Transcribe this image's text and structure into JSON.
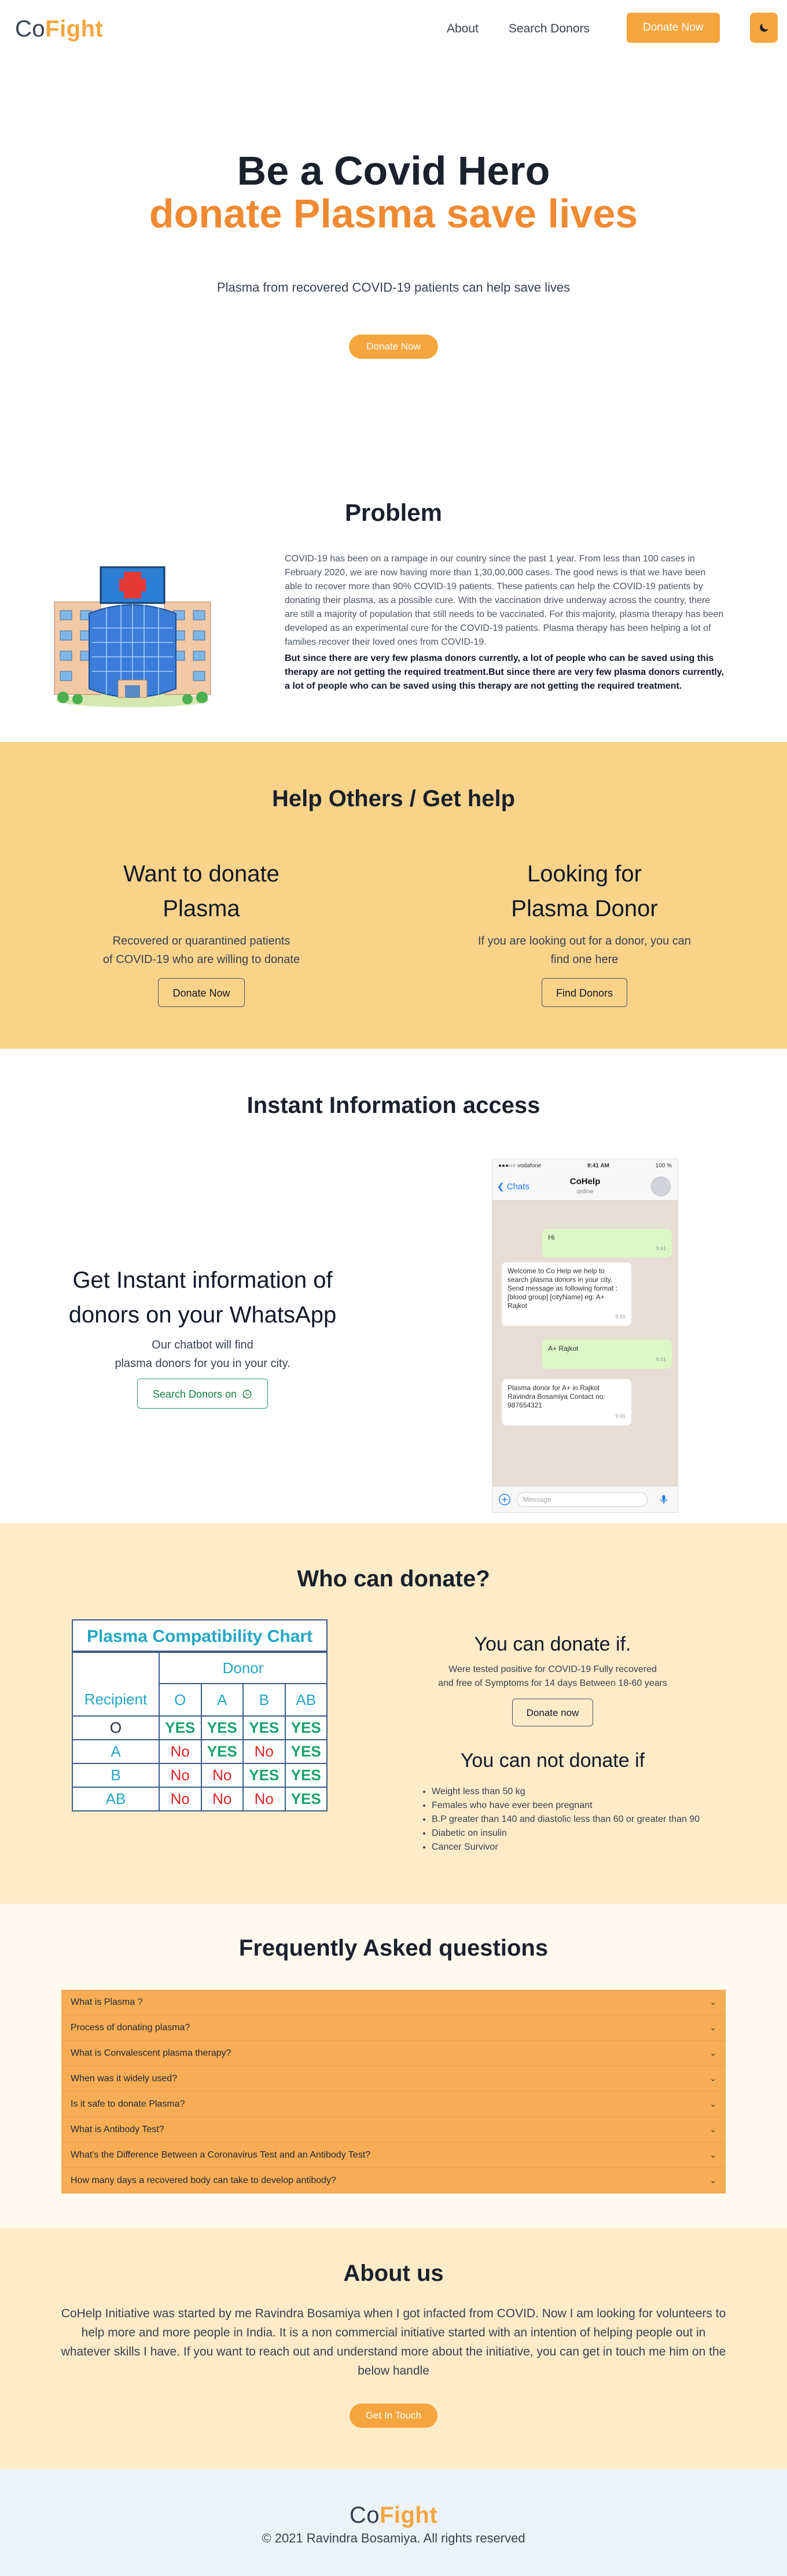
{
  "nav": {
    "logo_co": "Co",
    "logo_fight": "Fight",
    "links": [
      "About",
      "Search Donors"
    ],
    "donate_label": "Donate Now",
    "theme_icon": "moon-icon"
  },
  "hero": {
    "title_line1": "Be a Covid Hero",
    "title_line2": "donate Plasma save lives",
    "subtitle": "Plasma from recovered COVID-19 patients can help save lives",
    "button": "Donate Now"
  },
  "problem": {
    "title": "Problem",
    "paragraph": "COVID-19 has been on a rampage in our country since the past 1 year. From less than 100 cases in February 2020, we are now having more than 1,30,00,000 cases. The good news is that we have been able to recover more than 90% COVID-19 patients. These patients can help the COVID-19 patients by donating their plasma, as a possible cure. With the vaccination drive underway across the country, there are still a majority of population that still needs to be vaccinated. For this majority, plasma therapy has been developed as an experimental cure for the COVID-19 patients. Plasma therapy has been helping a lot of families recover their loved ones from COVID-19.",
    "bold": "But since there are very few plasma donors currently, a lot of people who can be saved using this therapy are not getting the required treatment.But since there are very few plasma donors currently, a lot of people who can be saved using this therapy are not getting the required treatment."
  },
  "help": {
    "title": "Help Others / Get help",
    "left": {
      "title": "Want to donate Plasma",
      "text_line1": "Recovered or quarantined patients",
      "text_line2": "of COVID-19 who are willing to donate",
      "button": "Donate Now"
    },
    "right": {
      "title": "Looking for Plasma Donor",
      "text_line1": "If you are looking out for a donor, you can",
      "text_line2": "find one here",
      "button": "Find Donors"
    }
  },
  "instant": {
    "title": "Instant Information access",
    "heading": "Get Instant information of donors on your WhatsApp",
    "text_line1": "Our chatbot will find",
    "text_line2": "plasma donors for you in your city.",
    "button": "Search Donors on"
  },
  "phone": {
    "status_left": "●●●○○ vodafone",
    "status_time": "9:41 AM",
    "status_right": "100 %",
    "back": "Chats",
    "name": "CoHelp",
    "sub": "online",
    "messages": [
      {
        "text": "Hi",
        "time": "9:41"
      },
      {
        "text": "Welcome to Co Help we help to search plasma donors in your city. Send message as following format : [blood group] [cityName] eg: A+ Rajkot",
        "time": "9:41"
      },
      {
        "text": "A+ Rajkot",
        "time": "9:41"
      },
      {
        "text": "Plasma donor for A+ in Rajkot Ravindra Bosamiya Contact no: 987654321",
        "time": "9:41"
      }
    ],
    "input_placeholder": "Message"
  },
  "who": {
    "title": "Who can donate?",
    "chart": {
      "title": "Plasma Compatibility Chart",
      "donor_label": "Donor",
      "recipient_label": "Recipient",
      "columns": [
        "O",
        "A",
        "B",
        "AB"
      ],
      "rows": [
        {
          "label": "O",
          "values": [
            "YES",
            "YES",
            "YES",
            "YES"
          ]
        },
        {
          "label": "A",
          "values": [
            "No",
            "YES",
            "No",
            "YES"
          ]
        },
        {
          "label": "B",
          "values": [
            "No",
            "No",
            "YES",
            "YES"
          ]
        },
        {
          "label": "AB",
          "values": [
            "No",
            "No",
            "No",
            "YES"
          ]
        }
      ]
    },
    "can_title": "You can donate if.",
    "can_text_line1": "Were tested positive for COVID-19 Fully recovered",
    "can_text_line2": "and free of Symptoms for 14 days Between 18-60 years",
    "can_button": "Donate now",
    "cannot_title": "You can not donate if",
    "cannot_list": [
      "Weight less than 50 kg",
      "Females who have ever been pregnant",
      "B.P greater than 140 and diastolic less than 60 or greater than 90",
      "Diabetic on insulin",
      "Cancer Survivor"
    ]
  },
  "faq": {
    "title": "Frequently Asked questions",
    "items": [
      "What is Plasma ?",
      "Process of donating plasma?",
      "What is Convalescent plasma therapy?",
      "When was it widely used?",
      "Is it safe to donate Plasma?",
      "What is Antibody Test?",
      "What's the Difference Between a Coronavirus Test and an Antibody Test?",
      "How many days a recovered body can take to develop antibody?"
    ]
  },
  "about": {
    "title": "About us",
    "text": "CoHelp Initiative was started by me Ravindra Bosamiya when I got infacted from COVID. Now I am looking for volunteers to help more and more people in India. It is a non commercial initiative started with an intention of helping people out in whatever skills I have. If you want to reach out and understand more about the initiative, you can get in touch me him on the below handle",
    "button": "Get In Touch"
  },
  "footer": {
    "logo_co": "Co",
    "logo_fight": "Fight",
    "copyright": "© 2021 Ravindra Bosamiya. All rights reserved"
  }
}
